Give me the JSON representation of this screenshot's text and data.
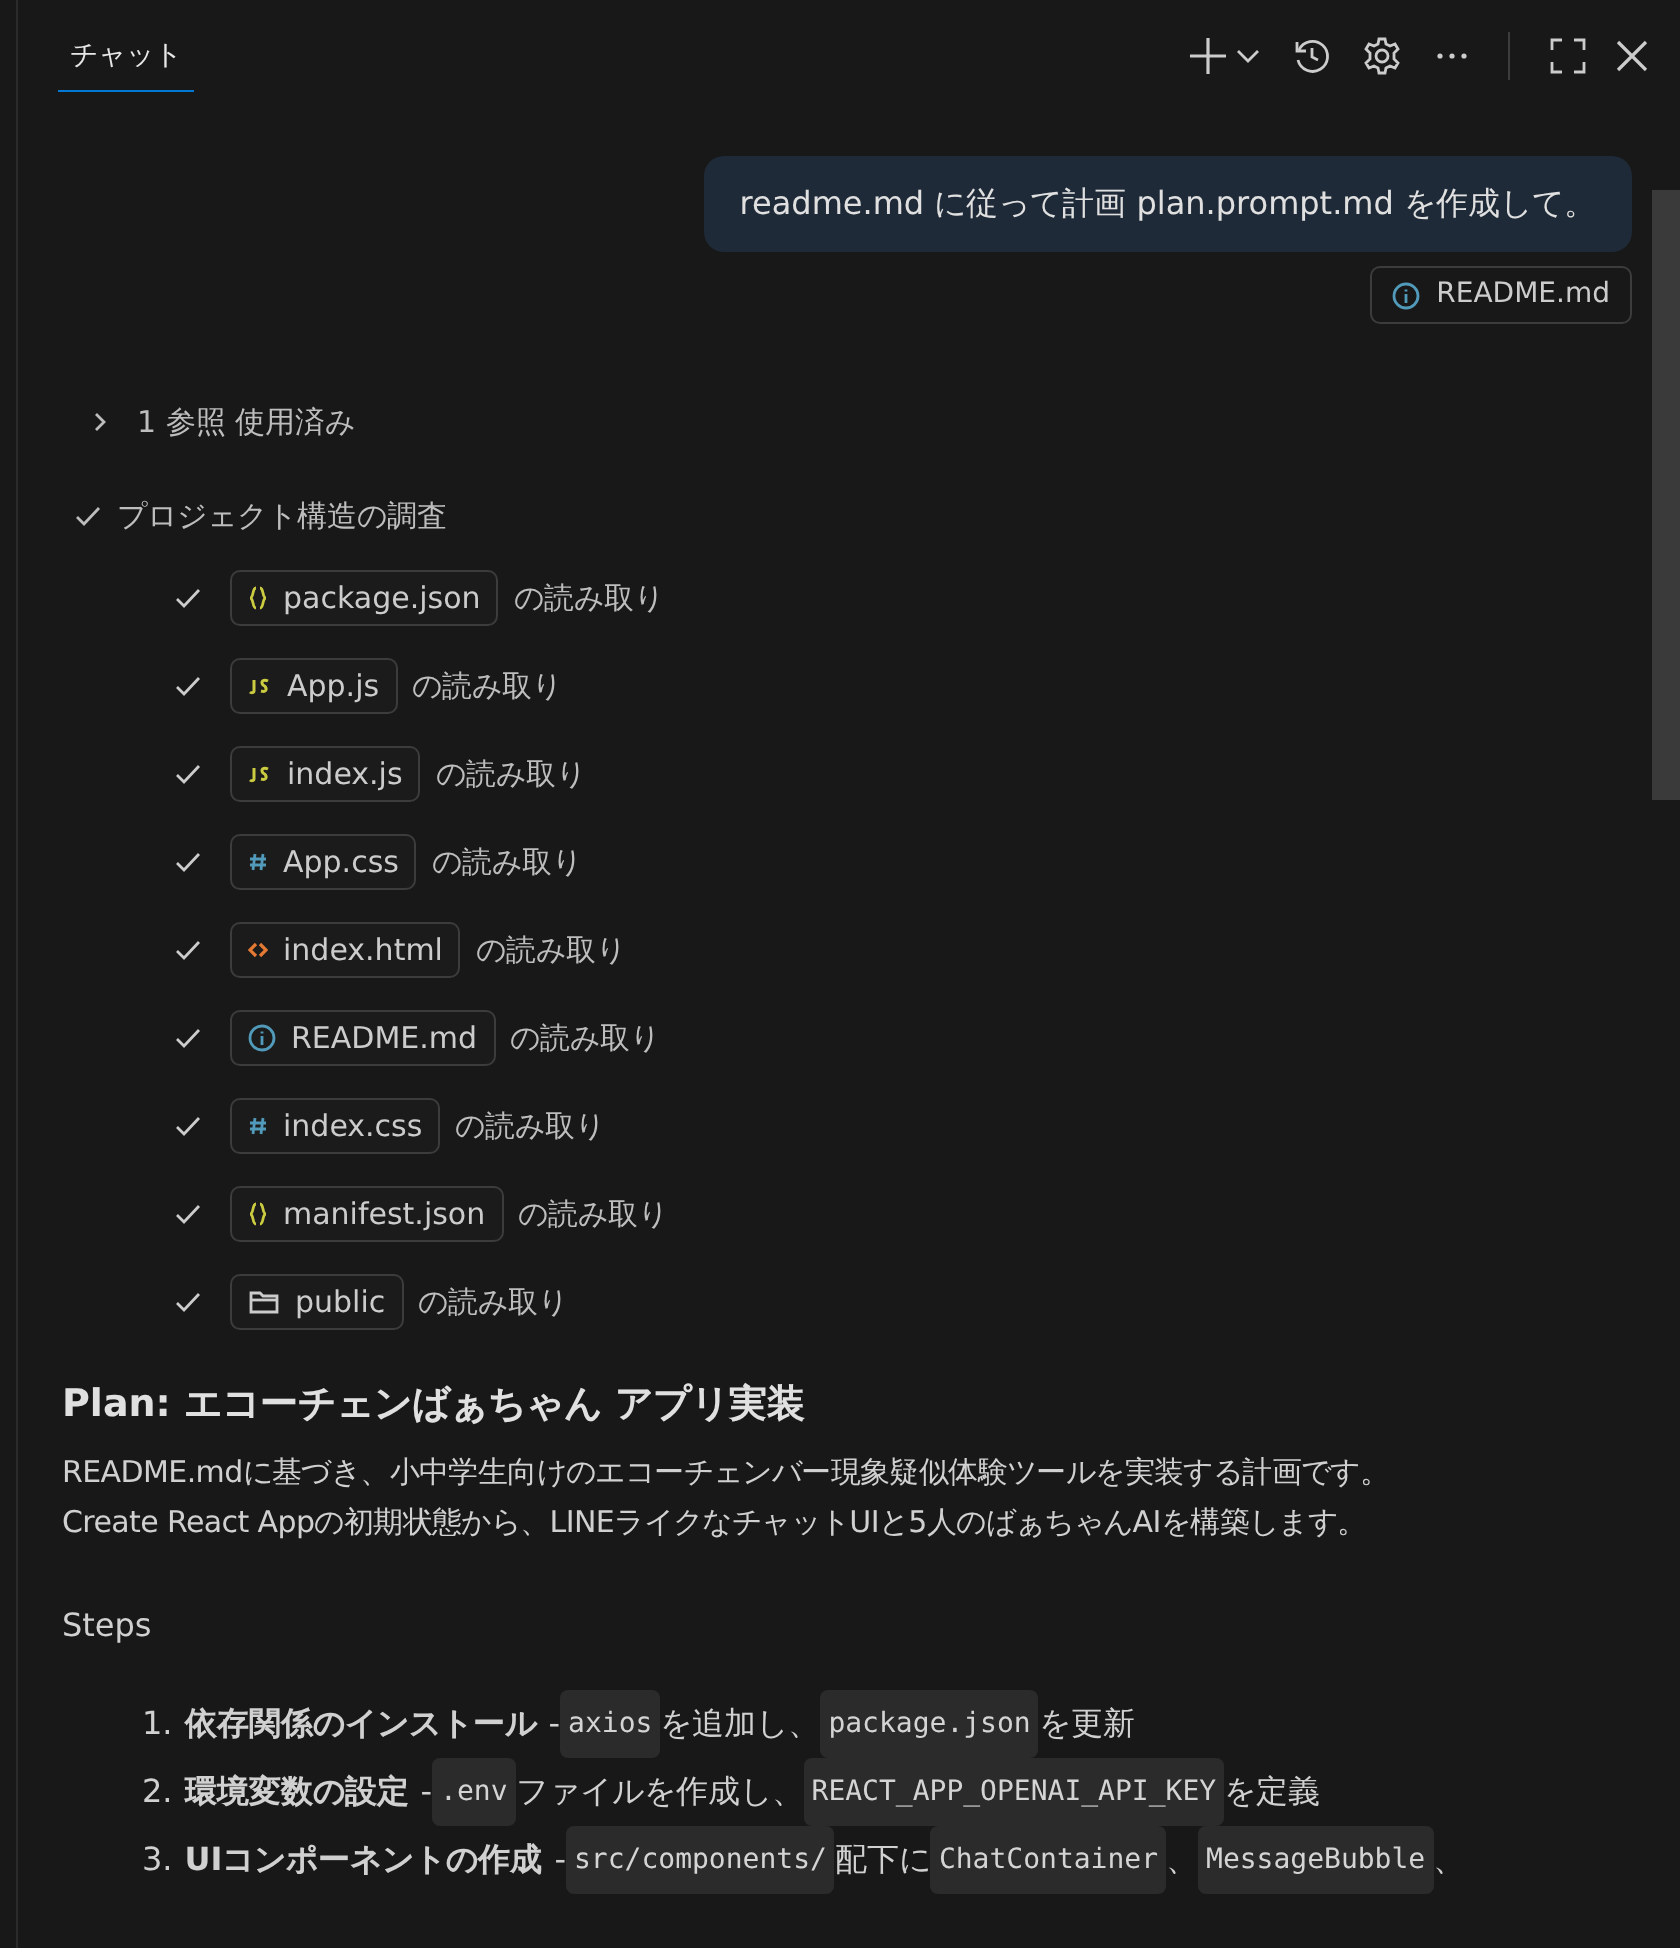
{
  "tab": {
    "label": "チャット",
    "selected": true
  },
  "user_message": {
    "text": "readme.md に従って計画 plan.prompt.md を作成して。",
    "attachment": {
      "kind": "info",
      "label": "README.md"
    }
  },
  "references": {
    "label": "1 参照 使用済み",
    "expanded": false
  },
  "task": {
    "label": "プロジェクト構造の調査",
    "done": true,
    "reads": [
      {
        "kind": "json",
        "file": "package.json",
        "suffix": "の読み取り",
        "done": true
      },
      {
        "kind": "js",
        "file": "App.js",
        "suffix": "の読み取り",
        "done": true
      },
      {
        "kind": "js",
        "file": "index.js",
        "suffix": "の読み取り",
        "done": true
      },
      {
        "kind": "css",
        "file": "App.css",
        "suffix": "の読み取り",
        "done": true
      },
      {
        "kind": "html",
        "file": "index.html",
        "suffix": "の読み取り",
        "done": true
      },
      {
        "kind": "info",
        "file": "README.md",
        "suffix": "の読み取り",
        "done": true
      },
      {
        "kind": "css",
        "file": "index.css",
        "suffix": "の読み取り",
        "done": true
      },
      {
        "kind": "json",
        "file": "manifest.json",
        "suffix": "の読み取り",
        "done": true
      },
      {
        "kind": "folder",
        "file": "public",
        "suffix": "の読み取り",
        "done": true
      }
    ]
  },
  "plan": {
    "title": "Plan: エコーチェンばぁちゃん アプリ実装",
    "description": [
      "README.mdに基づき、小中学生向けのエコーチェンバー現象疑似体験ツールを実装する計画です。",
      "Create React Appの初期状態から、LINEライクなチャットUIと5人のばぁちゃんAIを構築します。"
    ],
    "steps_heading": "Steps",
    "steps": [
      {
        "number": "1.",
        "title": "依存関係のインストール",
        "parts": [
          {
            "kind": "text",
            "text": "-"
          },
          {
            "kind": "code",
            "text": "axios"
          },
          {
            "kind": "text",
            "text": "を追加し、"
          },
          {
            "kind": "code",
            "text": "package.json"
          },
          {
            "kind": "text",
            "text": "を更新"
          }
        ]
      },
      {
        "number": "2.",
        "title": "環境変数の設定",
        "parts": [
          {
            "kind": "text",
            "text": "-"
          },
          {
            "kind": "code",
            "text": ".env"
          },
          {
            "kind": "text",
            "text": "ファイルを作成し、"
          },
          {
            "kind": "code",
            "text": "REACT_APP_OPENAI_API_KEY"
          },
          {
            "kind": "text",
            "text": "を定義"
          }
        ]
      },
      {
        "number": "3.",
        "title": "UIコンポーネントの作成",
        "parts": [
          {
            "kind": "text",
            "text": "-"
          },
          {
            "kind": "code",
            "text": "src/components/"
          },
          {
            "kind": "text",
            "text": "配下に"
          },
          {
            "kind": "code",
            "text": "ChatContainer"
          },
          {
            "kind": "text",
            "text": "、"
          },
          {
            "kind": "code",
            "text": "MessageBubble"
          },
          {
            "kind": "text",
            "text": "、"
          }
        ]
      }
    ]
  }
}
